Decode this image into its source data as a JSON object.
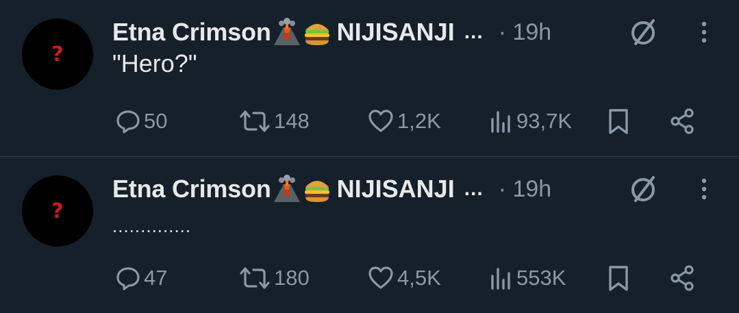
{
  "tweets": [
    {
      "author_name": "Etna Crimson",
      "author_org": "NIJISANJI",
      "truncation": "...",
      "time": "· 19h",
      "avatar_glyph": "?",
      "text": "\"Hero?\"",
      "stats": {
        "replies": "50",
        "retweets": "148",
        "likes": "1,2K",
        "views": "93,7K"
      }
    },
    {
      "author_name": "Etna Crimson",
      "author_org": "NIJISANJI",
      "truncation": "...",
      "time": "· 19h",
      "avatar_glyph": "?",
      "text": "..............",
      "stats": {
        "replies": "47",
        "retweets": "180",
        "likes": "4,5K",
        "views": "553K"
      }
    }
  ],
  "icons": {
    "name_emojis": [
      "volcano-emoji",
      "burger-emoji"
    ],
    "header": [
      "grok-icon",
      "more-icon"
    ],
    "actions": [
      "reply-icon",
      "retweet-icon",
      "like-icon",
      "views-icon",
      "bookmark-icon",
      "share-icon"
    ]
  },
  "colors": {
    "background": "#15202b",
    "text": "#e7e9ea",
    "muted": "#8b98a5",
    "divider": "#38444d",
    "avatar_glyph": "#d01818"
  }
}
